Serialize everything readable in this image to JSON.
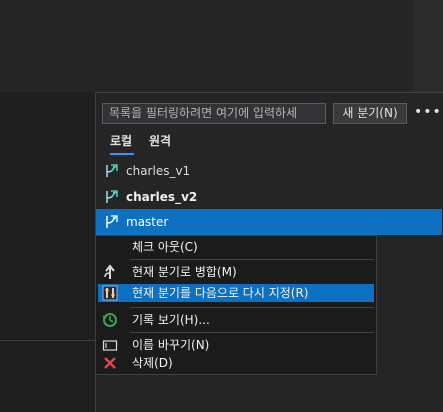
{
  "filter": {
    "placeholder": "목록을 필터링하려면 여기에 입력하세"
  },
  "toolbar": {
    "new_branch_label": "새 분기(N)",
    "more_label": "•••"
  },
  "tabs": {
    "local": "로컬",
    "remote": "원격"
  },
  "branches": [
    {
      "name": "charles_v1",
      "bold": false,
      "selected": false
    },
    {
      "name": "charles_v2",
      "bold": true,
      "selected": false
    },
    {
      "name": "master",
      "bold": false,
      "selected": true
    }
  ],
  "context_menu": {
    "checkout": "체크 아웃(C)",
    "merge": "현재 분기로 병합(M)",
    "rebase": "현재 분기를 다음으로 다시 지정(R)",
    "history": "기록 보기(H)...",
    "rename": "이름 바꾸기(N)",
    "delete": "삭제(D)"
  },
  "colors": {
    "accent": "#0e70c0",
    "tab_underline": "#3794ff",
    "delete": "#e04646",
    "history": "#3fa34d"
  }
}
